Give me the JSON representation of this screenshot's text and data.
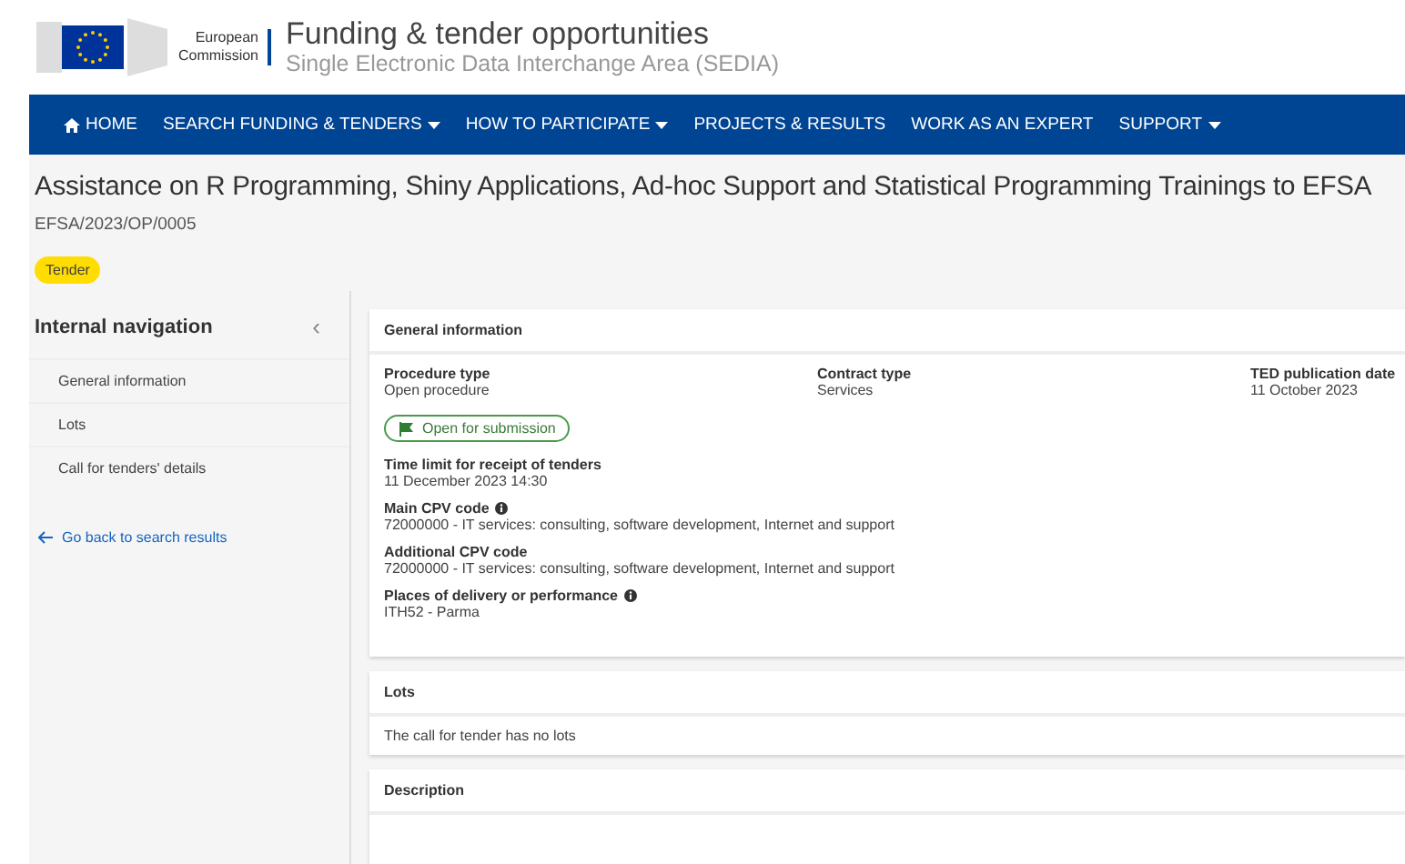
{
  "header": {
    "org_line_1": "European",
    "org_line_2": "Commission",
    "title": "Funding & tender opportunities",
    "subtitle": "Single Electronic Data Interchange Area (SEDIA)"
  },
  "nav": [
    {
      "label": "HOME",
      "kind": "home",
      "dropdown": false
    },
    {
      "label": "SEARCH FUNDING & TENDERS",
      "kind": "link",
      "dropdown": true
    },
    {
      "label": "HOW TO PARTICIPATE",
      "kind": "link",
      "dropdown": true
    },
    {
      "label": "PROJECTS & RESULTS",
      "kind": "link",
      "dropdown": false
    },
    {
      "label": "WORK AS AN EXPERT",
      "kind": "link",
      "dropdown": false
    },
    {
      "label": "SUPPORT",
      "kind": "link",
      "dropdown": true
    }
  ],
  "page": {
    "title": "Assistance on R Programming, Shiny Applications, Ad-hoc Support and Statistical Programming Trainings to EFSA",
    "reference": "EFSA/2023/OP/0005",
    "badge": "Tender"
  },
  "sidebar": {
    "title": "Internal navigation",
    "collapse": "‹",
    "items": [
      "General information",
      "Lots",
      "Call for tenders' details"
    ],
    "back_link": "Go back to search results"
  },
  "general": {
    "title": "General information",
    "top_fields": [
      {
        "label": "Procedure type",
        "value": "Open procedure"
      },
      {
        "label": "Contract type",
        "value": "Services"
      },
      {
        "label": "TED publication date",
        "value": "11 October 2023"
      }
    ],
    "status": "Open for submission",
    "fields": [
      {
        "label": "Time limit for receipt of tenders",
        "value": "11 December 2023 14:30",
        "info": false
      },
      {
        "label": "Main CPV code",
        "value": "72000000 - IT services: consulting, software development, Internet and support",
        "info": true
      },
      {
        "label": "Additional CPV code",
        "value": "72000000 - IT services: consulting, software development, Internet and support",
        "info": false
      },
      {
        "label": "Places of delivery or performance",
        "value": "ITH52 - Parma",
        "info": true
      }
    ]
  },
  "lots": {
    "title": "Lots",
    "text": "The call for tender has no lots"
  },
  "description": {
    "title": "Description"
  }
}
